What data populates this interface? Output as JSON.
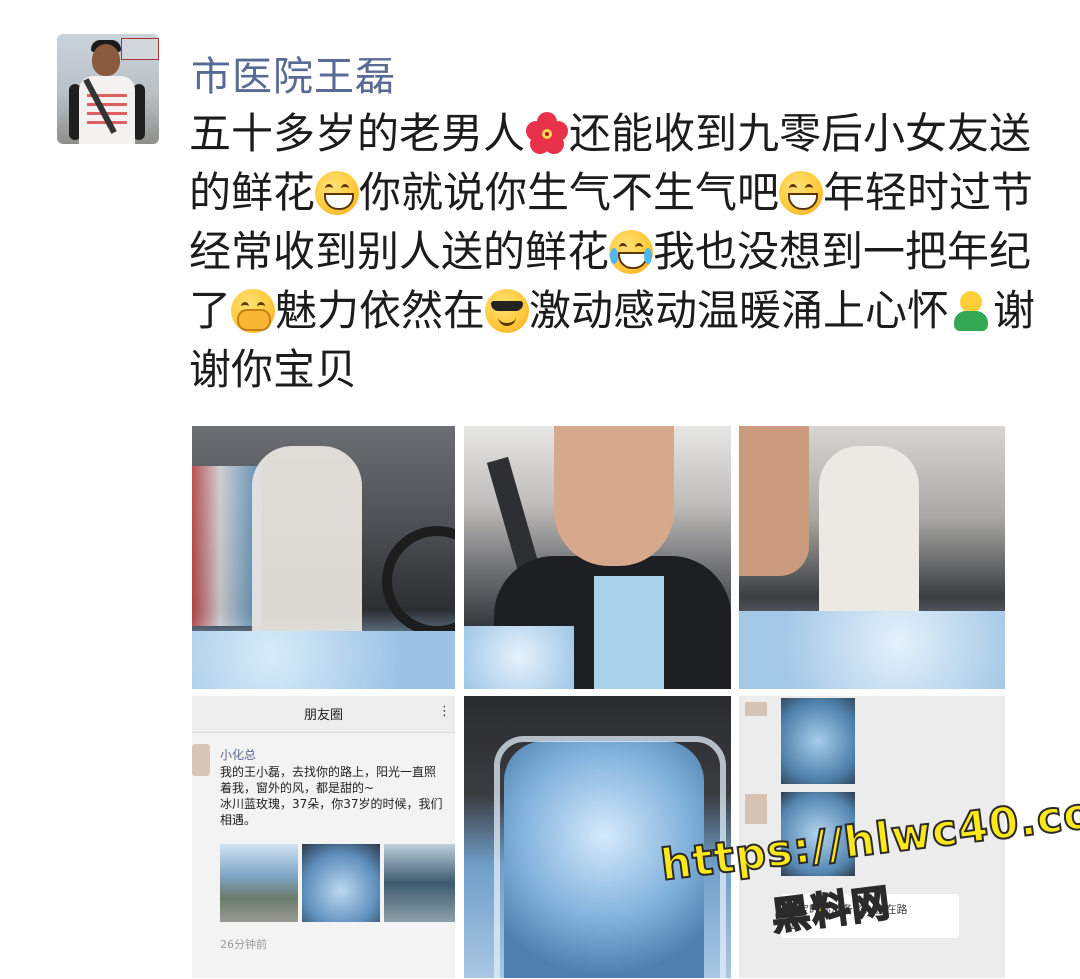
{
  "post": {
    "author": "市医院王磊",
    "segments": [
      "五十多岁的老男人",
      "还能收到九零后小女友送的鲜花",
      "你就说你生气不生气吧",
      "年轻时过节经常收到别人送的鲜花",
      "我也没想到一把年纪了",
      "魅力依然在",
      "激动感动温暖涌上心怀",
      "谢谢你宝贝"
    ],
    "emojis": [
      "hibiscus-flower",
      "grinning-face",
      "beaming-face",
      "tears-of-joy-face",
      "face-hand-covering",
      "sunglasses-face",
      "hugging-person"
    ]
  },
  "screenshot": {
    "header": "朋友圈",
    "more": "⋮",
    "user": "小化总",
    "text": "我的王小磊，去找你的路上，阳光一直照\n着我，窗外的风，都是甜的~\n冰川蓝玫瑰，37朵，你37岁的时候，我们\n相遇。",
    "time": "26分钟前"
  },
  "chat": {
    "message": "宝宝时你准备了...在在路\n上"
  },
  "watermark": {
    "url": "https://hlwc40.com",
    "name": "黑料网"
  }
}
